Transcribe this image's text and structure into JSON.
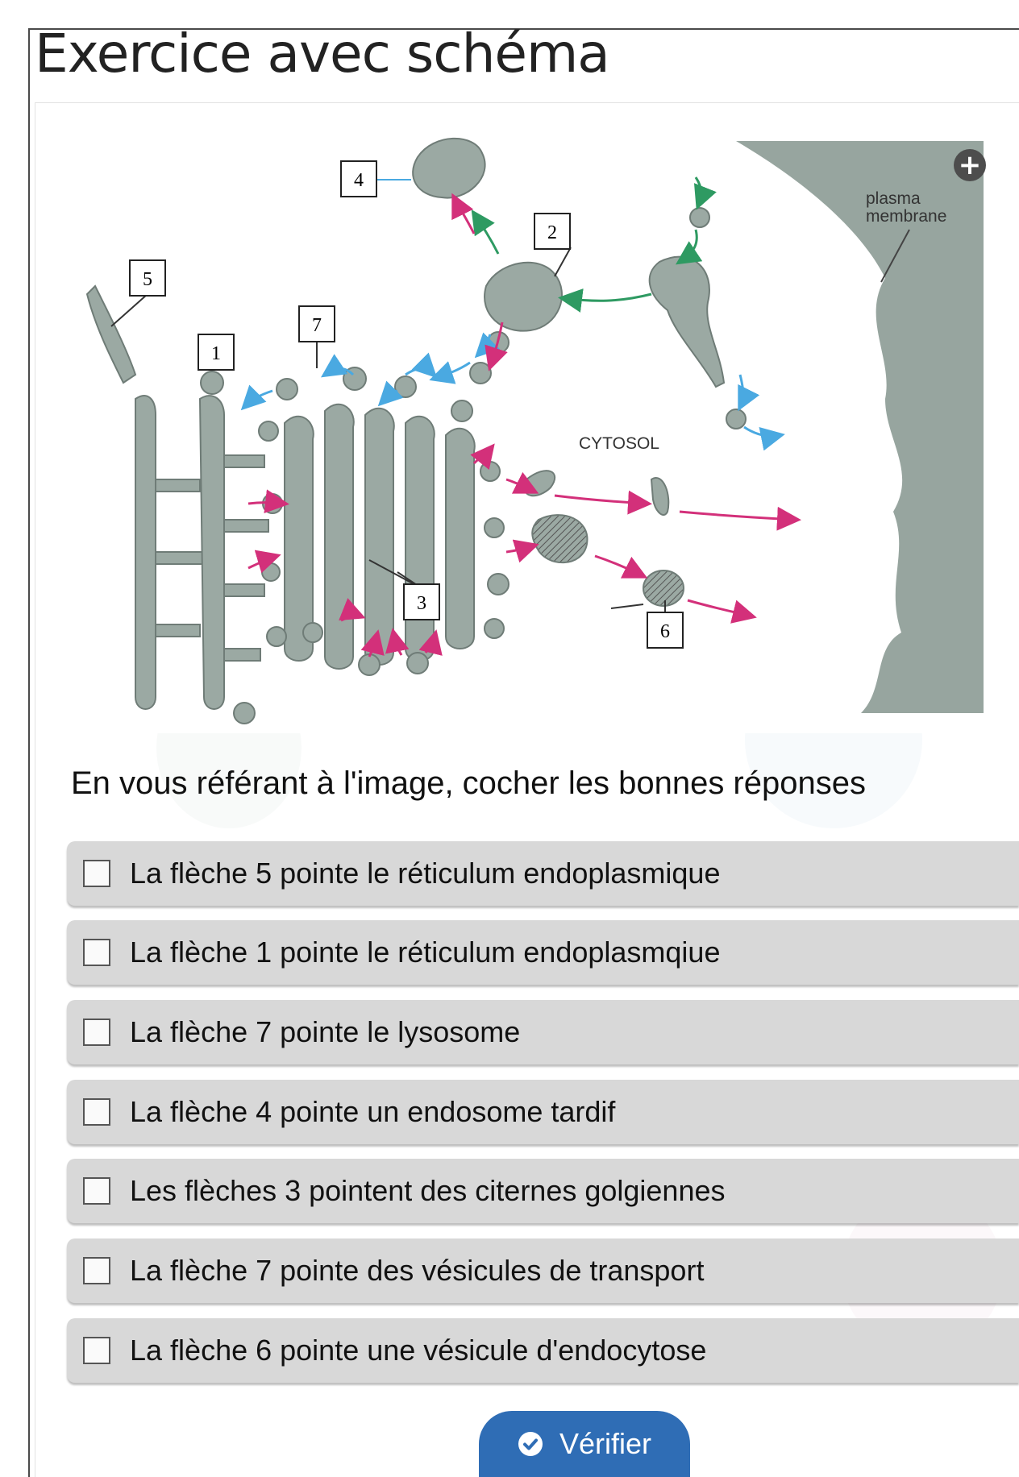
{
  "page": {
    "title": "Exercice avec schéma"
  },
  "diagram": {
    "labels": {
      "plasma_membrane": [
        "plasma",
        "membrane"
      ],
      "cytosol": "CYTOSOL"
    },
    "callouts": [
      "4",
      "2",
      "5",
      "7",
      "1",
      "3",
      "6"
    ]
  },
  "question": "En vous référant à l'image, cocher les bonnes réponses",
  "options": [
    {
      "label": "La flèche 5 pointe le réticulum endoplasmique",
      "checked": false
    },
    {
      "label": "La flèche 1 pointe le réticulum endoplasmqiue",
      "checked": false
    },
    {
      "label": "La flèche 7 pointe le lysosome",
      "checked": false
    },
    {
      "label": "La flèche 4 pointe un endosome tardif",
      "checked": false
    },
    {
      "label": "Les flèches 3 pointent des citernes golgiennes",
      "checked": false
    },
    {
      "label": "La flèche 7 pointe des vésicules de transport",
      "checked": false
    },
    {
      "label": "La flèche 6 pointe une vésicule d'endocytose",
      "checked": false
    }
  ],
  "buttons": {
    "verify": "Vérifier",
    "zoom_icon": "plus-icon"
  },
  "colors": {
    "organelle": "#9ba9a3",
    "membrane_bg": "#97a59f",
    "arrow_green": "#2e9a62",
    "arrow_blue": "#4aa9e1",
    "arrow_magenta": "#d3307a",
    "button_blue": "#2f6db5",
    "option_bg": "#d8d8d8"
  }
}
